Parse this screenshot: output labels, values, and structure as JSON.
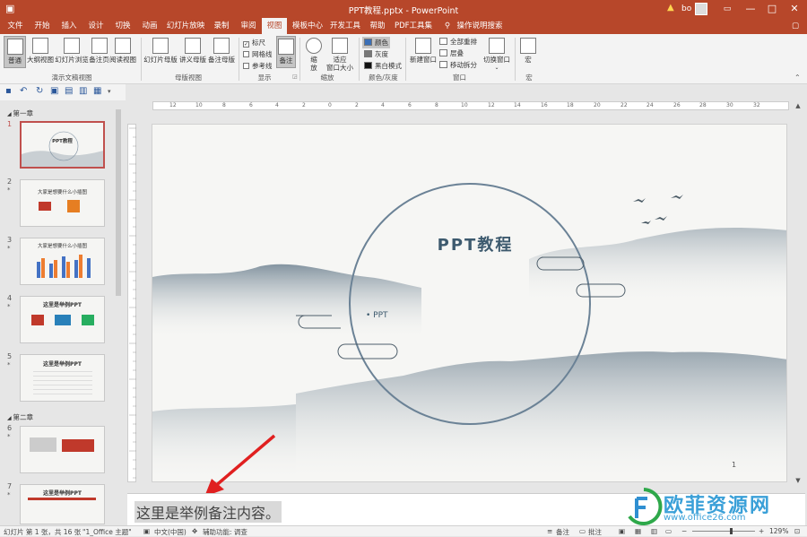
{
  "window": {
    "title": "PPT教程.pptx - PowerPoint",
    "user": "bo",
    "controls": [
      "—",
      "□",
      "✕"
    ]
  },
  "tabs": [
    "文件",
    "开始",
    "插入",
    "设计",
    "切换",
    "动画",
    "幻灯片放映",
    "录制",
    "审阅",
    "视图",
    "模板中心",
    "开发工具",
    "帮助",
    "PDF工具集"
  ],
  "active_tab": "视图",
  "search_label": "操作说明搜索",
  "ribbon": {
    "presentation_views": {
      "group_label": "演示文稿视图",
      "buttons": [
        "普通",
        "大纲视图",
        "幻灯片浏览",
        "备注页",
        "阅读视图"
      ]
    },
    "master_views": {
      "group_label": "母版视图",
      "buttons": [
        "幻灯片母版",
        "讲义母版",
        "备注母版"
      ]
    },
    "show": {
      "group_label": "显示",
      "checkboxes": [
        {
          "label": "标尺",
          "checked": true
        },
        {
          "label": "网格线",
          "checked": false
        },
        {
          "label": "参考线",
          "checked": false
        }
      ],
      "notes_button": "备注"
    },
    "zoom": {
      "group_label": "缩放",
      "zoom_button": "缩\n放",
      "fit_button": "适应\n窗口大小"
    },
    "color": {
      "group_label": "颜色/灰度",
      "items": [
        "颜色",
        "灰度",
        "黑白模式"
      ]
    },
    "window": {
      "group_label": "窗口",
      "new_window": "新建窗口",
      "items": [
        "全部重排",
        "层叠",
        "移动拆分"
      ],
      "switch": "切换窗口"
    },
    "macro": {
      "group_label": "宏",
      "button": "宏"
    }
  },
  "thumbnails": {
    "sections": [
      "第一章",
      "第二章"
    ],
    "slides": [
      {
        "num": "1",
        "title": "PPT教程",
        "selected": true
      },
      {
        "num": "2",
        "title": "大家是想要什么小插图"
      },
      {
        "num": "3",
        "title": "大家是想要什么小插图"
      },
      {
        "num": "4",
        "title": "这里是举例PPT"
      },
      {
        "num": "5",
        "title": "这里是举例PPT"
      },
      {
        "num": "6",
        "title": ""
      },
      {
        "num": "7",
        "title": "这里是举例PPT"
      }
    ]
  },
  "slide": {
    "title": "PPT教程",
    "bullet": "• PPT",
    "page_number": "1"
  },
  "ruler_ticks": [
    "12",
    "10",
    "8",
    "6",
    "4",
    "2",
    "0",
    "2",
    "4",
    "6",
    "8",
    "10",
    "12",
    "14",
    "16",
    "18",
    "20",
    "22",
    "24",
    "26",
    "28",
    "30",
    "32"
  ],
  "notes": {
    "text": "这里是举例备注内容。"
  },
  "status": {
    "slide_info": "幻灯片 第 1 张，共 16 张",
    "theme": "\"1_Office 主题\"",
    "language": "中文(中国)",
    "accessibility": "辅助功能: 调查",
    "notes": "备注",
    "comments": "批注",
    "zoom": "129%"
  },
  "watermark": {
    "text": "欧菲资源网",
    "url": "www.office26.com"
  },
  "colors": {
    "accent": "#b7472a",
    "slide_title": "#3d5a6e",
    "arrow": "#e02020",
    "watermark": "#3aa0d8"
  }
}
